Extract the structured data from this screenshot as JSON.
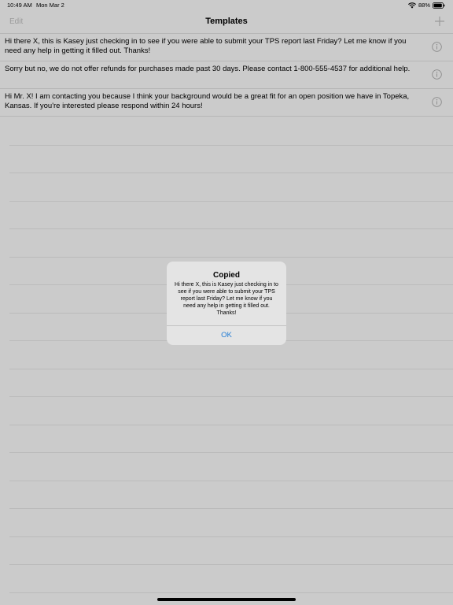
{
  "status_bar": {
    "time": "10:49 AM",
    "date": "Mon Mar 2",
    "battery": "88%",
    "icons": [
      "wifi-icon",
      "battery-icon"
    ]
  },
  "nav": {
    "edit_label": "Edit",
    "title": "Templates",
    "add_icon": "plus-icon"
  },
  "templates": [
    {
      "text": "Hi there X, this is Kasey just checking in to see if you were able to submit your TPS report last Friday? Let me know if you need any help in getting it filled out. Thanks!"
    },
    {
      "text": "Sorry but no, we do not offer refunds for purchases made past 30 days. Please contact 1-800-555-4537 for additional help."
    },
    {
      "text": "Hi Mr. X! I am contacting you because I think your background would be a great fit for an open position we have in Topeka, Kansas. If you're interested please respond within 24 hours!"
    }
  ],
  "alert": {
    "title": "Copied",
    "message": "Hi there X, this is Kasey just checking in to see if you were able to submit your TPS report last Friday? Let me know if you need any help in getting it filled out. Thanks!",
    "ok_label": "OK"
  },
  "colors": {
    "background": "#cbcbcb",
    "alert_background": "#e4e4e4",
    "link_blue": "#1f7bd4",
    "disabled_gray": "#9a9a9a"
  }
}
